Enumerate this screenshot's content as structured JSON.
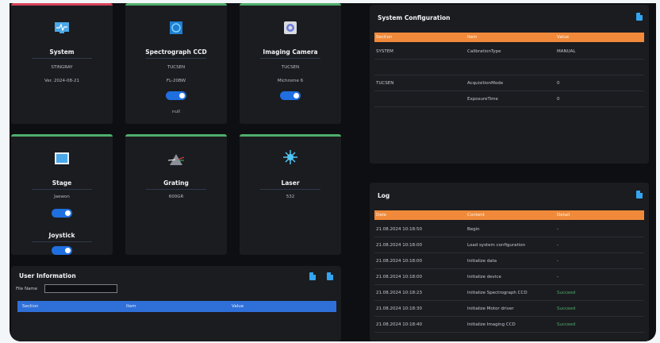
{
  "cards": {
    "system": {
      "title": "System",
      "lines": [
        "STINGRAY",
        "Ver. 2024-08-21"
      ],
      "icon": "monitor-icon"
    },
    "spectro": {
      "title": "Spectrograph CCD",
      "lines": [
        "TUCSEN",
        "FL-20BW"
      ],
      "null_label": "null",
      "toggle_on": true,
      "icon": "ccd-sensor-icon"
    },
    "imaging": {
      "title": "Imaging Camera",
      "lines": [
        "TUCSEN",
        "Michrome 6"
      ],
      "toggle_on": true,
      "icon": "camera-icon"
    },
    "stage": {
      "title": "Stage",
      "lines": [
        "Jaewon"
      ],
      "toggle_on": true,
      "icon": "stage-icon"
    },
    "joystick": {
      "title": "Joystick",
      "toggle_on": true
    },
    "grating": {
      "title": "Grating",
      "lines": [
        "600GR"
      ],
      "icon": "prism-icon"
    },
    "laser": {
      "title": "Laser",
      "lines": [
        "532"
      ],
      "icon": "laser-icon"
    }
  },
  "user_info": {
    "title": "User Information",
    "file_name_label": "File Name",
    "file_name_value": "",
    "columns": [
      "Section",
      "Item",
      "Value"
    ]
  },
  "system_config": {
    "title": "System Configuration",
    "columns": [
      "Section",
      "Item",
      "Value"
    ],
    "rows": [
      [
        "SYSTEM",
        "CalibrationType",
        "MANUAL"
      ],
      [
        "",
        "",
        ""
      ],
      [
        "TUCSEN",
        "AcquisitionMode",
        "0"
      ],
      [
        "",
        "ExposureTime",
        "0"
      ]
    ]
  },
  "log": {
    "title": "Log",
    "columns": [
      "Date",
      "Content",
      "Detail"
    ],
    "rows": [
      [
        "21.08.2024 10:18:50",
        "Begin",
        "-"
      ],
      [
        "21.08.2024 10:18:00",
        "Load system configuration",
        "-"
      ],
      [
        "21.08.2024 10:18:00",
        "Initialize data",
        "-"
      ],
      [
        "21.08.2024 10:18:00",
        "Initialize device",
        "-"
      ],
      [
        "21.08.2024 10:18:23",
        "Initialize Spectrograph CCD",
        "Succeed"
      ],
      [
        "21.08.2024 10:18:30",
        "Initialize Motor driver",
        "Succeed"
      ],
      [
        "21.08.2024 10:18:40",
        "Initialize Imaging CCD",
        "Succeed"
      ]
    ]
  }
}
